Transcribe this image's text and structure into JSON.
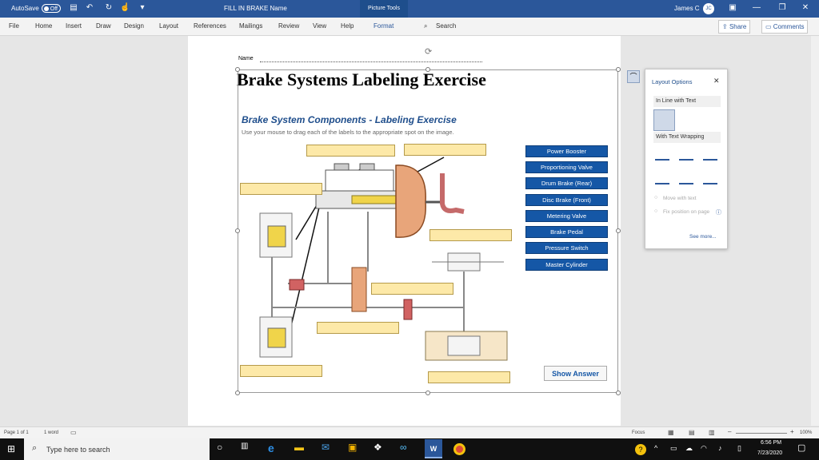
{
  "titlebar": {
    "autosave": "AutoSave",
    "toggle": "Off",
    "doc_title": "FILL IN BRAKE Name",
    "picture_tools": "Picture Tools",
    "user": "James C",
    "initials": "JC"
  },
  "ribbon": {
    "tabs": [
      "File",
      "Home",
      "Insert",
      "Draw",
      "Design",
      "Layout",
      "References",
      "Mailings",
      "Review",
      "View",
      "Help",
      "Format"
    ],
    "search": "Search",
    "share": "Share",
    "comments": "Comments"
  },
  "document": {
    "name_label": "Name",
    "heading": "Brake Systems Labeling Exercise",
    "subtitle": "Brake System Components - Labeling Exercise",
    "instructions": "Use your mouse to drag each of the labels to the appropriate spot on the image.",
    "labels": [
      "Power Booster",
      "Proportioning Valve",
      "Drum Brake (Rear)",
      "Disc Brake (Front)",
      "Metering Valve",
      "Brake Pedal",
      "Pressure Switch",
      "Master Cylinder"
    ],
    "show_answer": "Show Answer"
  },
  "layout_options": {
    "title": "Layout Options",
    "inline": "In Line with Text",
    "wrapping": "With Text Wrapping",
    "move_with_text": "Move with text",
    "fix_position": "Fix position on page",
    "see_more": "See more..."
  },
  "statusbar": {
    "page": "Page 1 of 1",
    "words": "1 word",
    "focus": "Focus",
    "zoom": "100%"
  },
  "taskbar": {
    "search": "Type here to search",
    "time": "6:56 PM",
    "date": "7/23/2020"
  },
  "colors": {
    "word_blue": "#2b579a",
    "label_blue": "#1557a6",
    "blank_fill": "#fde9a8",
    "booster": "#e8a57a"
  }
}
